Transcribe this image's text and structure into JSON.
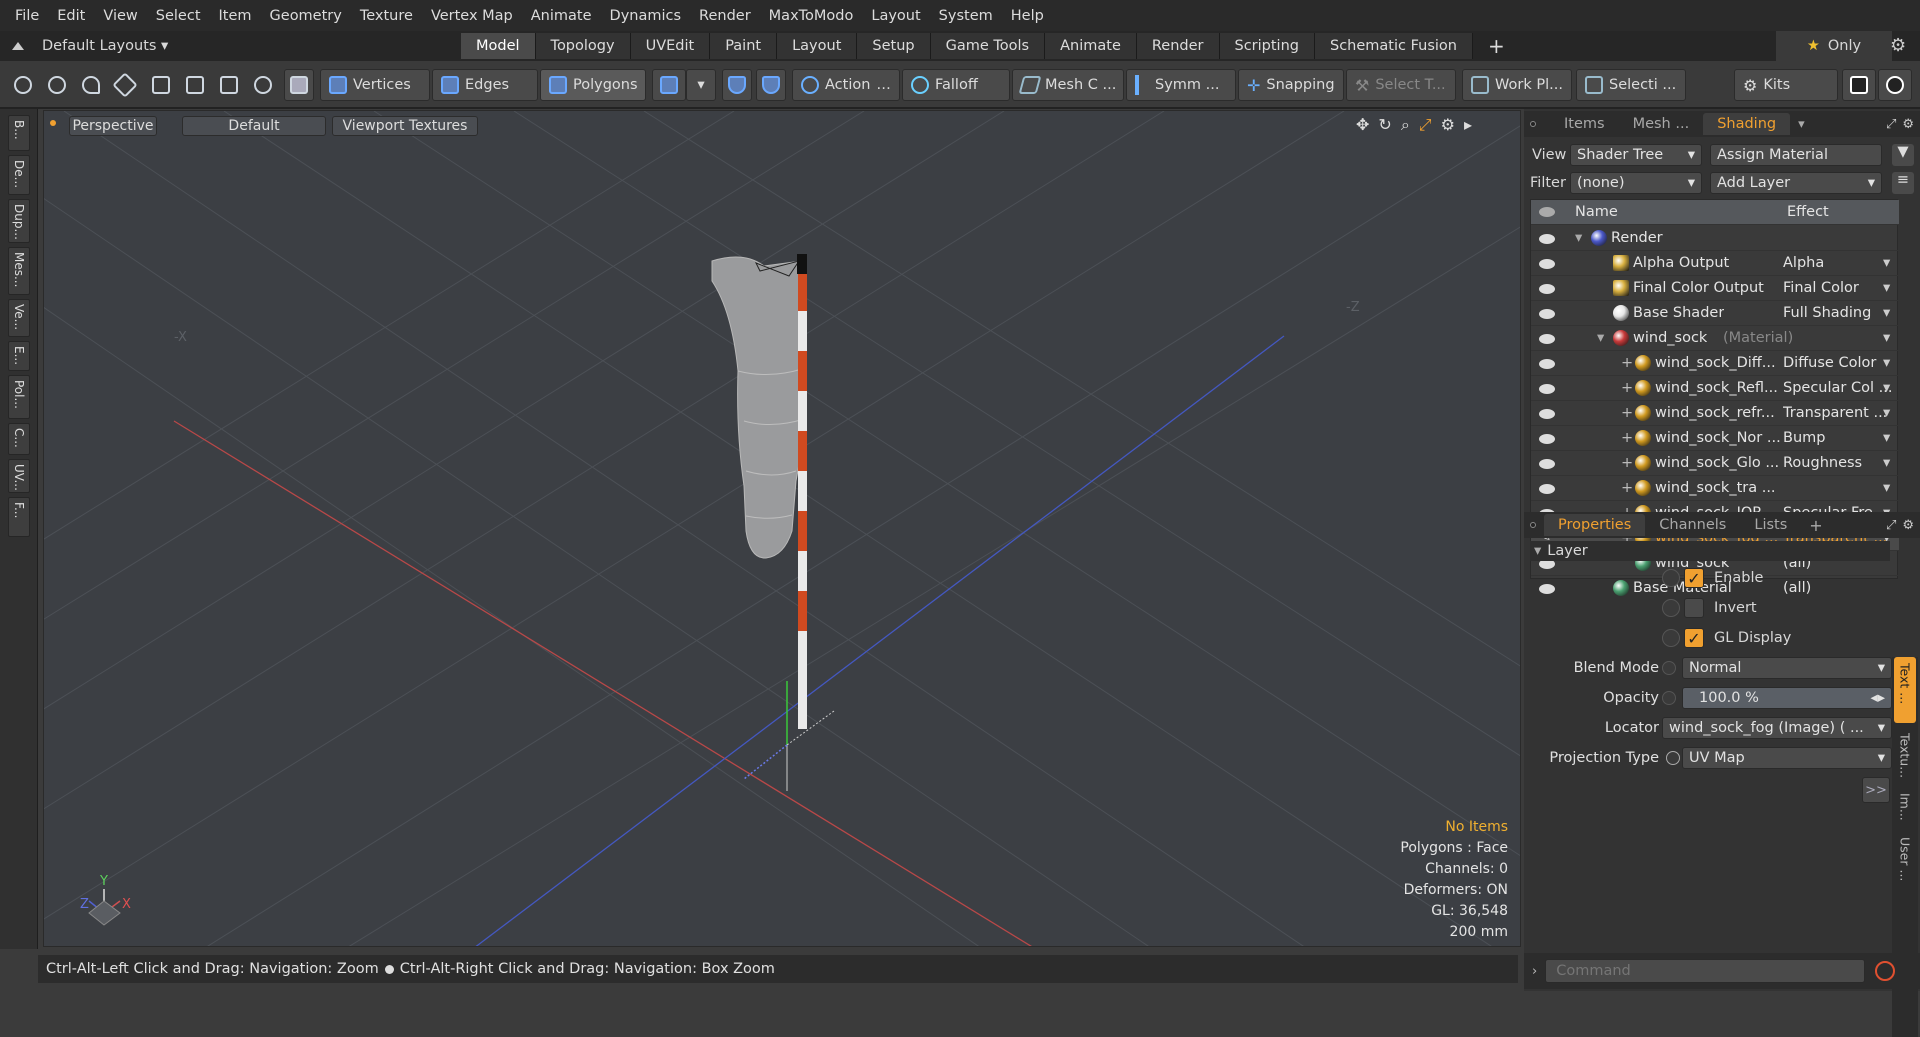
{
  "menu": [
    "File",
    "Edit",
    "View",
    "Select",
    "Item",
    "Geometry",
    "Texture",
    "Vertex Map",
    "Animate",
    "Dynamics",
    "Render",
    "MaxToModo",
    "Layout",
    "System",
    "Help"
  ],
  "modebar": {
    "layout_selector": "Default Layouts",
    "tabs": [
      "Model",
      "Topology",
      "UVEdit",
      "Paint",
      "Layout",
      "Setup",
      "Game Tools",
      "Animate",
      "Render",
      "Scripting",
      "Schematic Fusion"
    ],
    "active_tab": "Model",
    "only_label": "Only"
  },
  "toolbar": {
    "vertices": "Vertices",
    "edges": "Edges",
    "polygons": "Polygons",
    "action": "Action",
    "falloff": "Falloff",
    "mesh_c": "Mesh C ...",
    "symm": "Symm ...",
    "snapping": "Snapping",
    "select_t": "Select T...",
    "work_pl": "Work Pl...",
    "selecti": "Selecti ...",
    "kits": "Kits"
  },
  "left_tabs": [
    "B...",
    "De...",
    "Dup...",
    "Mes...",
    "Ve...",
    "E...",
    "Pol...",
    "C...",
    "UV...",
    "F..."
  ],
  "viewport": {
    "view_mode": "Perspective",
    "style": "Default",
    "textures": "Viewport Textures",
    "axis_label_x": "X",
    "axis_label_y": "Y",
    "axis_label_z": "Z",
    "ghost_x": "-X",
    "ghost_z": "-Z",
    "info": {
      "items": "No Items",
      "polygons": "Polygons : Face",
      "channels": "Channels: 0",
      "deformers": "Deformers: ON",
      "gl": "GL: 36,548",
      "scale": "200 mm"
    }
  },
  "status_bar": {
    "hint1": "Ctrl-Alt-Left Click and Drag: Navigation: Zoom",
    "hint2": "Ctrl-Alt-Right Click and Drag: Navigation: Box Zoom"
  },
  "top_panel": {
    "tabs": [
      "Items",
      "Mesh ...",
      "Shading"
    ],
    "active_tab": "Shading",
    "view_label": "View",
    "view_value": "Shader Tree",
    "assign_material": "Assign Material",
    "filter_label": "Filter",
    "filter_value": "(none)",
    "add_layer": "Add Layer",
    "col_name": "Name",
    "col_effect": "Effect",
    "rows": [
      {
        "name": "Render",
        "effect": "",
        "indent": 0,
        "icon": "render"
      },
      {
        "name": "Alpha Output",
        "effect": "Alpha",
        "indent": 1,
        "icon": "output"
      },
      {
        "name": "Final Color Output",
        "effect": "Final Color",
        "indent": 1,
        "icon": "output"
      },
      {
        "name": "Base Shader",
        "effect": "Full Shading",
        "indent": 1,
        "icon": "shader"
      },
      {
        "name": "wind_sock",
        "suffix": "(Material)",
        "effect": "",
        "indent": 1,
        "icon": "material"
      },
      {
        "name": "wind_sock_Diff...",
        "effect": "Diffuse Color",
        "indent": 2,
        "icon": "image"
      },
      {
        "name": "wind_sock_Refl...",
        "effect": "Specular Col ...",
        "indent": 2,
        "icon": "image"
      },
      {
        "name": "wind_sock_refr...",
        "effect": "Transparent ...",
        "indent": 2,
        "icon": "image"
      },
      {
        "name": "wind_sock_Nor ...",
        "effect": "Bump",
        "indent": 2,
        "icon": "image"
      },
      {
        "name": "wind_sock_Glo ...",
        "effect": "Roughness",
        "indent": 2,
        "icon": "image"
      },
      {
        "name": "wind_sock_tra ...",
        "effect": "",
        "indent": 2,
        "icon": "image"
      },
      {
        "name": "wind_sock_IOR...",
        "effect": "Specular Fre...",
        "indent": 2,
        "icon": "image"
      },
      {
        "name": "wind_sock_fog ...",
        "effect": "Transparent ...",
        "indent": 2,
        "icon": "image",
        "selected": true
      },
      {
        "name": "wind_sock",
        "effect": "(all)",
        "indent": 2,
        "icon": "mask"
      },
      {
        "name": "Base Material",
        "effect": "(all)",
        "indent": 1,
        "icon": "mask"
      }
    ]
  },
  "bottom_panel": {
    "tabs": [
      "Properties",
      "Channels",
      "Lists"
    ],
    "active_tab": "Properties",
    "section": "Layer",
    "enable": {
      "label": "Enable",
      "checked": true
    },
    "invert": {
      "label": "Invert",
      "checked": false
    },
    "gl_display": {
      "label": "GL Display",
      "checked": true
    },
    "blend_mode": {
      "label": "Blend Mode",
      "value": "Normal"
    },
    "opacity": {
      "label": "Opacity",
      "value": "100.0 %"
    },
    "locator": {
      "label": "Locator",
      "value": "wind_sock_fog (Image) ( ..."
    },
    "projection_type": {
      "label": "Projection Type",
      "value": "UV Map"
    },
    "more": ">>",
    "side_tabs": [
      "Text ...",
      "Textu...",
      "Im...",
      "User ..."
    ]
  },
  "command": {
    "placeholder": "Command"
  },
  "colors": {
    "accent": "#f0a030",
    "grid": "#4a4e54",
    "x_axis": "#c83a3a",
    "z_axis": "#3a4ac8",
    "y_axis": "#3ac83a"
  }
}
